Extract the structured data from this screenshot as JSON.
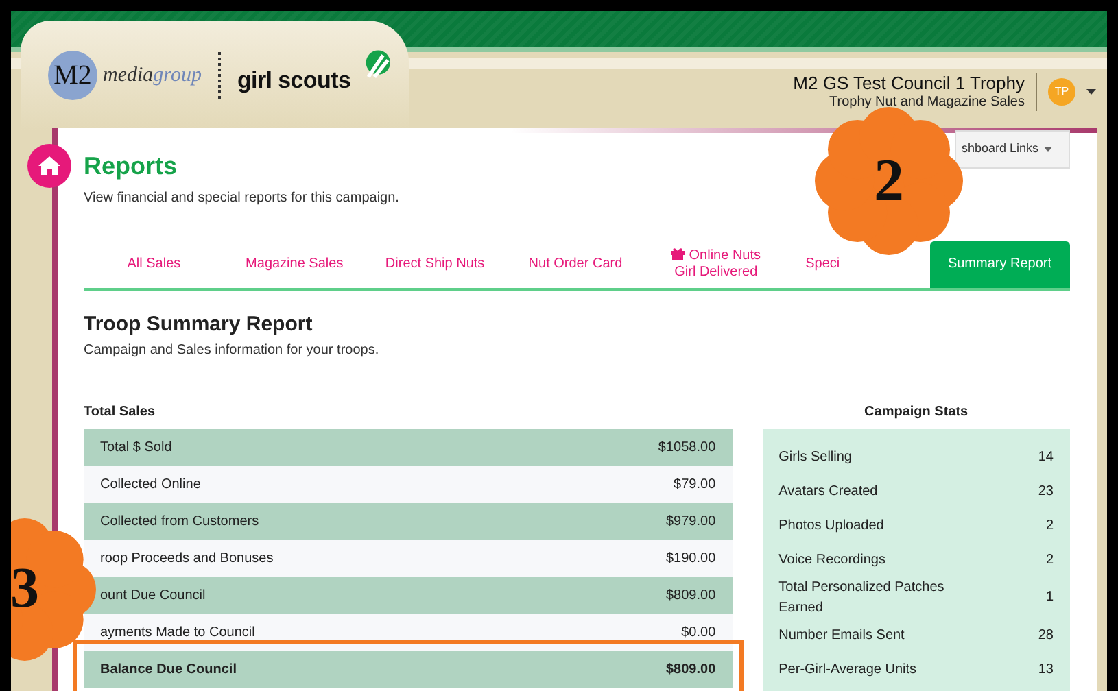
{
  "header": {
    "brand_logo": {
      "initials": "M2",
      "word_1": "media",
      "word_2": "group"
    },
    "partner_logo": "girl scouts",
    "council": "M2 GS Test Council 1 Trophy",
    "campaign": "Trophy Nut and Magazine Sales",
    "avatar": "TP"
  },
  "dashboard_links": "shboard Links",
  "page": {
    "title": "Reports",
    "subtitle": "View financial and special reports for this campaign."
  },
  "tabs": [
    {
      "label": "All Sales",
      "kind": "plain",
      "selected": false
    },
    {
      "label": "Magazine Sales",
      "kind": "plain",
      "selected": false
    },
    {
      "label": "Direct Ship Nuts",
      "kind": "plain",
      "selected": false
    },
    {
      "label": "Nut Order Card",
      "kind": "plain",
      "selected": false
    },
    {
      "label": "Online Nuts Girl Delivered",
      "kind": "decorated",
      "selected": false
    },
    {
      "label": "Speci",
      "kind": "cut",
      "selected": false
    },
    {
      "label": "Summary Report",
      "kind": "plain",
      "selected": true
    }
  ],
  "report": {
    "title": "Troop Summary Report",
    "subtitle": "Campaign and Sales information for your troops."
  },
  "total_sales": {
    "heading": "Total Sales",
    "rows": [
      {
        "label": "Total $ Sold",
        "value": "$1058.00",
        "kind": "line",
        "highlighted": false
      },
      {
        "label": "Collected Online",
        "value": "$79.00",
        "kind": "line",
        "highlighted": false
      },
      {
        "label": "Collected from Customers",
        "value": "$979.00",
        "kind": "line",
        "highlighted": false
      },
      {
        "label": "roop Proceeds and Bonuses",
        "value": "$190.00",
        "kind": "line",
        "highlighted": false
      },
      {
        "label": "ount Due Council",
        "value": "$809.00",
        "kind": "line",
        "highlighted": false
      },
      {
        "label": "ayments Made to Council",
        "value": "$0.00",
        "kind": "line",
        "highlighted": false
      },
      {
        "label": "Balance Due Council",
        "value": "$809.00",
        "kind": "total",
        "highlighted": true
      }
    ]
  },
  "campaign_stats": {
    "heading": "Campaign Stats",
    "rows": [
      {
        "label": "Girls Selling",
        "value": "14"
      },
      {
        "label": "Avatars Created",
        "value": "23"
      },
      {
        "label": "Photos Uploaded",
        "value": "2"
      },
      {
        "label": "Voice Recordings",
        "value": "2"
      },
      {
        "label": "Total Personalized Patches Earned",
        "value": "1"
      },
      {
        "label": "Number Emails Sent",
        "value": "28"
      },
      {
        "label": "Per-Girl-Average Units",
        "value": "13"
      }
    ]
  },
  "markers": [
    {
      "number": "2"
    },
    {
      "number": "3"
    }
  ]
}
